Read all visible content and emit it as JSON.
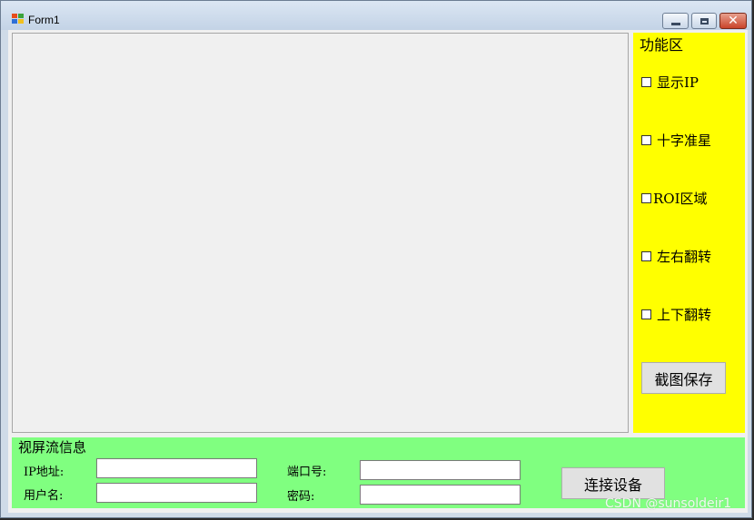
{
  "window": {
    "title": "Form1",
    "minimize_icon": "minimize-icon",
    "maximize_icon": "maximize-icon",
    "close_icon": "close-icon",
    "close_glyph": "✕"
  },
  "function_area": {
    "title": "功能区",
    "checkboxes": [
      {
        "label": "显示IP",
        "checked": false
      },
      {
        "label": "十字准星",
        "checked": false
      },
      {
        "label": "ROI区域",
        "checked": false
      },
      {
        "label": "左右翻转",
        "checked": false
      },
      {
        "label": "上下翻转",
        "checked": false
      }
    ],
    "snapshot_button": "截图保存",
    "background_color": "#ffff00"
  },
  "stream_info": {
    "title": "视屏流信息",
    "ip_label": "IP地址:",
    "ip_value": "",
    "user_label": "用户名:",
    "user_value": "",
    "port_label": "端口号:",
    "port_value": "",
    "password_label": "密码:",
    "password_value": "",
    "connect_button": "连接设备",
    "background_color": "#80ff80"
  },
  "watermark": "CSDN @sunsoldeir1"
}
